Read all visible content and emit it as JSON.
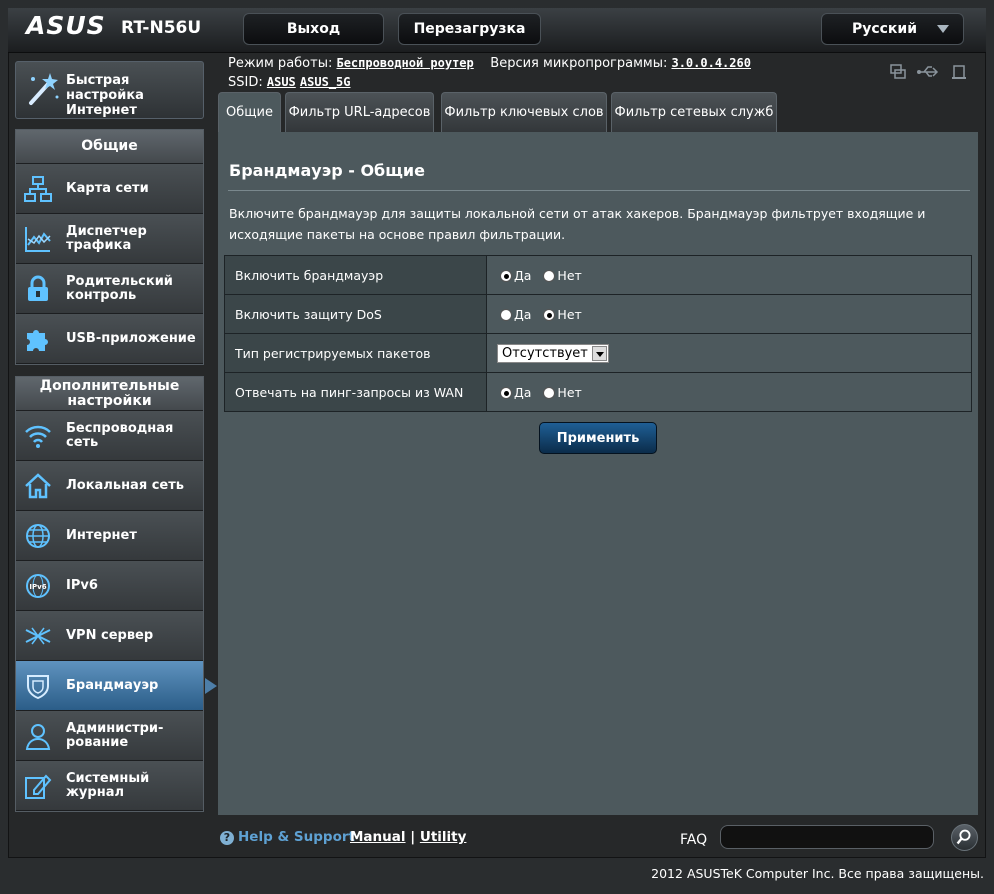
{
  "header": {
    "logo": "ASUS",
    "model": "RT-N56U",
    "logout_label": "Выход",
    "reboot_label": "Перезагрузка",
    "language": "Русский"
  },
  "status": {
    "mode_label": "Режим работы:",
    "mode_value": "Беспроводной роутер",
    "firmware_label": "Версия микропрограммы:",
    "firmware_value": "3.0.0.4.260",
    "ssid_label": "SSID:",
    "ssid1": "ASUS",
    "ssid2": "ASUS_5G"
  },
  "sidebar": {
    "quick_setup": "Быстрая настройка Интернет",
    "general_title": "Общие",
    "general_items": [
      {
        "label": "Карта сети"
      },
      {
        "label": "Диспетчер трафика"
      },
      {
        "label": "Родительский контроль"
      },
      {
        "label": "USB-приложение"
      }
    ],
    "advanced_title": "Дополнительные настройки",
    "advanced_items": [
      {
        "label": "Беспроводная сеть"
      },
      {
        "label": "Локальная сеть"
      },
      {
        "label": "Интернет"
      },
      {
        "label": "IPv6"
      },
      {
        "label": "VPN сервер"
      },
      {
        "label": "Брандмауэр"
      },
      {
        "label": "Администри-рование"
      },
      {
        "label": "Системный журнал"
      }
    ]
  },
  "tabs": [
    "Общие",
    "Фильтр URL-адресов",
    "Фильтр ключевых слов",
    "Фильтр сетевых служб"
  ],
  "content": {
    "title": "Брандмауэр - Общие",
    "description": "Включите брандмауэр для защиты локальной сети от атак хакеров. Брандмауэр фильтрует входящие и исходящие пакеты на основе правил фильтрации.",
    "rows": [
      {
        "label": "Включить брандмауэр",
        "yes": "Да",
        "no": "Нет",
        "selected": "yes"
      },
      {
        "label": "Включить защиту DoS",
        "yes": "Да",
        "no": "Нет",
        "selected": "no"
      },
      {
        "label": "Тип регистрируемых пакетов",
        "select_value": "Отсутствует"
      },
      {
        "label": "Отвечать на пинг-запросы из WAN",
        "yes": "Да",
        "no": "Нет",
        "selected": "yes"
      }
    ],
    "apply_label": "Применить"
  },
  "footer": {
    "help": "Help & Support",
    "manual": "Manual",
    "separator": "|",
    "utility": "Utility",
    "faq": "FAQ",
    "copyright": "2012 ASUSTeK Computer Inc. Все права защищены."
  }
}
